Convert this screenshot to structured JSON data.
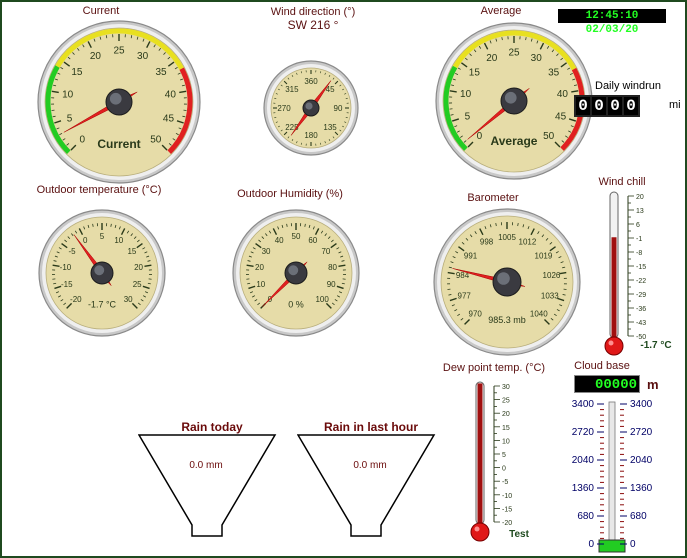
{
  "clock": "12:45:10 02/03/20",
  "gauges": {
    "current": {
      "title": "Current",
      "face_label": "Current",
      "min": 0,
      "max": 50,
      "ticks": [
        "0",
        "5",
        "10",
        "15",
        "20",
        "25",
        "30",
        "35",
        "40",
        "45",
        "50"
      ],
      "value": 3
    },
    "wind_direction": {
      "title": "Wind direction (°)",
      "subtitle": "SW  216 °",
      "ticks": [
        "360",
        "45",
        "90",
        "135",
        "180",
        "225",
        "270",
        "315"
      ],
      "value": 216
    },
    "average": {
      "title": "Average",
      "face_label": "Average",
      "min": 0,
      "max": 50,
      "ticks": [
        "0",
        "5",
        "10",
        "15",
        "20",
        "25",
        "30",
        "35",
        "40",
        "45",
        "50"
      ],
      "value": 1
    },
    "outdoor_temp": {
      "title": "Outdoor temperature (°C)",
      "face_label": "-1.7 °C",
      "min": -20,
      "max": 30,
      "ticks": [
        "-20",
        "-15",
        "-10",
        "-5",
        "0",
        "5",
        "10",
        "15",
        "20",
        "25",
        "30"
      ],
      "value": -1.7
    },
    "humidity": {
      "title": "Outdoor Humidity (%)",
      "face_label": "0 %",
      "min": 0,
      "max": 100,
      "ticks": [
        "0",
        "10",
        "20",
        "30",
        "40",
        "50",
        "60",
        "70",
        "80",
        "90",
        "100"
      ],
      "value": 0
    },
    "barometer": {
      "title": "Barometer",
      "face_label": "985.3 mb",
      "min": 970,
      "max": 1040,
      "ticks": [
        "970",
        "977",
        "984",
        "991",
        "998",
        "1005",
        "1012",
        "1019",
        "1026",
        "1033",
        "1040"
      ],
      "value": 985.3
    }
  },
  "windrun": {
    "title": "Daily windrun",
    "digits": [
      "0",
      "0",
      "0",
      "0"
    ],
    "unit": "mi"
  },
  "wind_chill": {
    "title": "Wind chill",
    "ticks": [
      "20",
      "13",
      "6",
      "-1",
      "-8",
      "-15",
      "-22",
      "-29",
      "-36",
      "-43",
      "-50"
    ],
    "value_label": "-1.7 °C",
    "level": 0.69
  },
  "dew_point": {
    "title": "Dew point temp. (°C)",
    "ticks": [
      "30",
      "25",
      "20",
      "15",
      "10",
      "5",
      "0",
      "-5",
      "-10",
      "-15",
      "-20"
    ],
    "value_label": "Test",
    "level": 0.99
  },
  "cloud_base": {
    "title": "Cloud base",
    "display": "00000",
    "unit": "m",
    "ticks": [
      "3400",
      "2720",
      "2040",
      "1360",
      "680",
      "0"
    ],
    "level": 0.0
  },
  "rain_today": {
    "title": "Rain today",
    "value": "0.0 mm"
  },
  "rain_last_hour": {
    "title": "Rain in last hour",
    "value": "0.0 mm"
  },
  "colors": {
    "frame": "#1f4a1f",
    "label": "#5a1010",
    "face": "#e6dca8",
    "needle": "#e02020",
    "digital": "#22ff22"
  }
}
